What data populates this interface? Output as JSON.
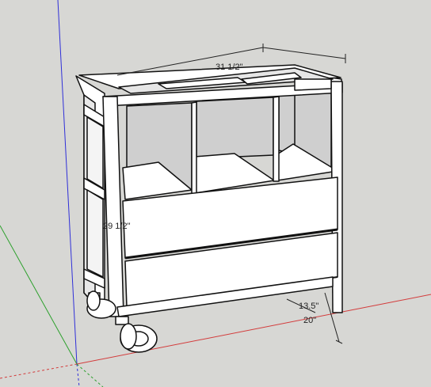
{
  "app": "SketchUp",
  "scene": "rolling storage cart with shelves and two drawers",
  "colors": {
    "background": "#d7d7d4",
    "model_white": "#ffffff",
    "shadow_face": "#cfcfcf",
    "edge": "#111111",
    "axis_red": "#d33b3b",
    "axis_green": "#2ca02c",
    "axis_blue": "#2f2fd8"
  },
  "dimensions": {
    "width": "31 1/2\"",
    "height": "29 1/2\"",
    "depth_inner": "13.5\"",
    "depth_outer": "20\""
  }
}
